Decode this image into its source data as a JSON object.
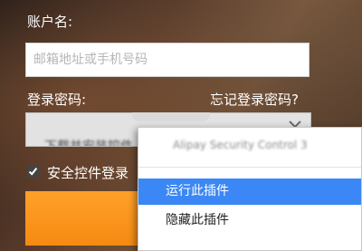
{
  "form": {
    "account_label": "账户名:",
    "account_placeholder": "邮箱地址或手机号码",
    "password_label": "登录密码:",
    "forgot_password_link": "忘记登录密码?",
    "security_control_label": "安全控件登录"
  },
  "plugin_field": {
    "blurred_text": "下载并安装控件"
  },
  "context_menu": {
    "title_blurred": "Alipay Security Control 3",
    "items": [
      {
        "label": "运行此插件",
        "selected": true
      },
      {
        "label": "隐藏此插件",
        "selected": false
      }
    ]
  },
  "colors": {
    "login_button": "#f7931e",
    "menu_highlight": "#3b87f5"
  },
  "icons": {
    "dropdown": "chevron-down-icon",
    "checkbox": "checkbox-checked"
  }
}
